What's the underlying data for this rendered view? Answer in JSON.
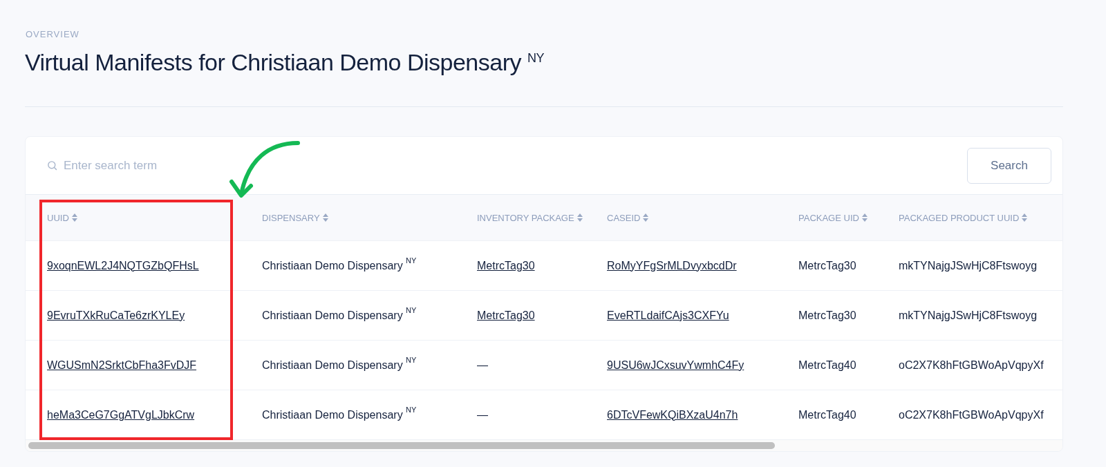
{
  "breadcrumb": "OVERVIEW",
  "title": "Virtual Manifests for Christiaan Demo Dispensary $^{NY}$",
  "search": {
    "placeholder": "Enter search term",
    "button": "Search"
  },
  "table": {
    "columns": [
      "UUID",
      "DISPENSARY",
      "INVENTORY PACKAGE",
      "CASEID",
      "PACKAGE UID",
      "PACKAGED PRODUCT UUID"
    ],
    "rows": [
      [
        {
          "text": "9xoqnEWL2J4NQTGZbQFHsL",
          "link": true
        },
        {
          "text": "Christiaan Demo Dispensary $^{NY}$",
          "link": false
        },
        {
          "text": "MetrcTag30",
          "link": true
        },
        {
          "text": "RoMyYFgSrMLDvyxbcdDr",
          "link": true
        },
        {
          "text": "MetrcTag30",
          "link": false
        },
        {
          "text": "mkTYNajgJSwHjC8Ftswoyg",
          "link": false
        }
      ],
      [
        {
          "text": "9EvruTXkRuCaTe6zrKYLEy",
          "link": true
        },
        {
          "text": "Christiaan Demo Dispensary $^{NY}$",
          "link": false
        },
        {
          "text": "MetrcTag30",
          "link": true
        },
        {
          "text": "EveRTLdaifCAjs3CXFYu",
          "link": true
        },
        {
          "text": "MetrcTag30",
          "link": false
        },
        {
          "text": "mkTYNajgJSwHjC8Ftswoyg",
          "link": false
        }
      ],
      [
        {
          "text": "WGUSmN2SrktCbFha3FvDJF",
          "link": true
        },
        {
          "text": "Christiaan Demo Dispensary $^{NY}$",
          "link": false
        },
        {
          "text": "—",
          "link": false
        },
        {
          "text": "9USU6wJCxsuvYwmhC4Fy",
          "link": true
        },
        {
          "text": "MetrcTag40",
          "link": false
        },
        {
          "text": "oC2X7K8hFtGBWoApVqpyXf",
          "link": false
        }
      ],
      [
        {
          "text": "heMa3CeG7GgATVgLJbkCrw",
          "link": true
        },
        {
          "text": "Christiaan Demo Dispensary $^{NY}$",
          "link": false
        },
        {
          "text": "—",
          "link": false
        },
        {
          "text": "6DTcVFewKQiBXzaU4n7h",
          "link": true
        },
        {
          "text": "MetrcTag40",
          "link": false
        },
        {
          "text": "oC2X7K8hFtGBWoApVqpyXf",
          "link": false
        }
      ]
    ]
  }
}
